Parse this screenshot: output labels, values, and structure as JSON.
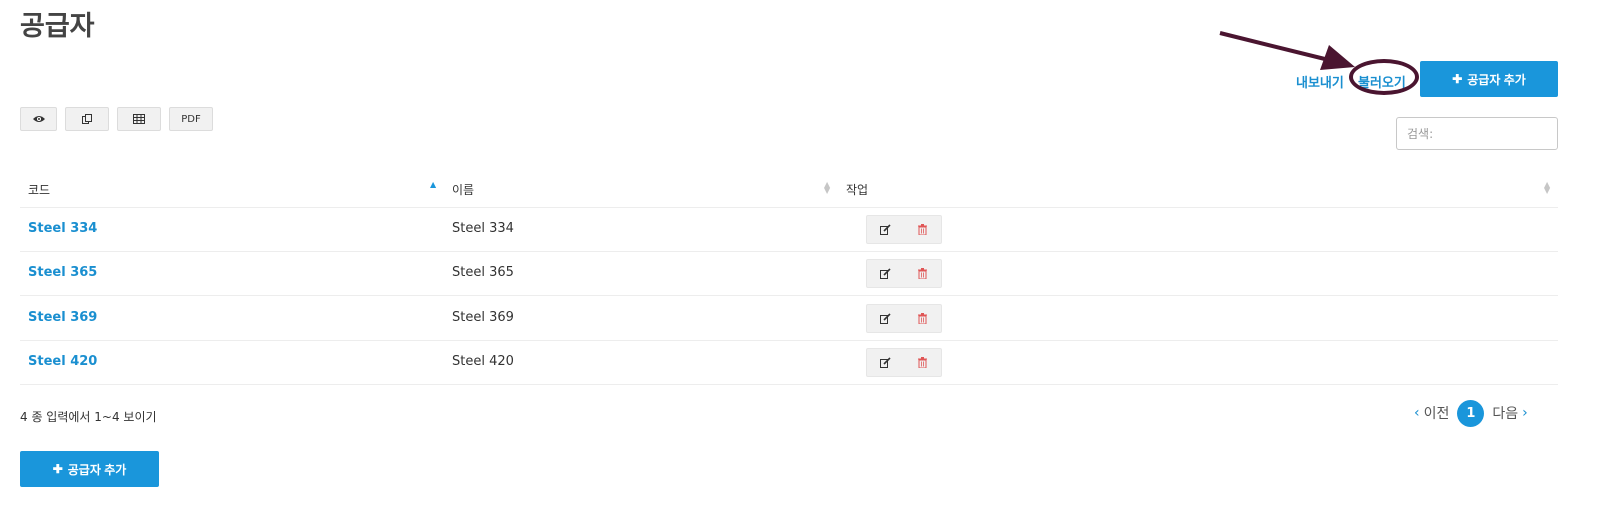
{
  "page": {
    "title": "공급자"
  },
  "actions": {
    "export_label": "내보내기",
    "import_label": "불러오기",
    "add_supplier_label": "공급자 추가",
    "add_icon": "plus-icon"
  },
  "toolbar": {
    "buttons": [
      {
        "icon": "eye-icon",
        "label": ""
      },
      {
        "icon": "copy-icon",
        "label": ""
      },
      {
        "icon": "table-icon",
        "label": ""
      },
      {
        "icon": "pdf",
        "label": "PDF"
      }
    ]
  },
  "search": {
    "placeholder": "검색:"
  },
  "table": {
    "columns": [
      {
        "label": "코드",
        "sort": "ascending"
      },
      {
        "label": "이름",
        "sort": "none"
      },
      {
        "label": "작업",
        "sort": "none"
      }
    ],
    "rows": [
      {
        "code": "Steel 334",
        "name": "Steel 334"
      },
      {
        "code": "Steel 365",
        "name": "Steel 365"
      },
      {
        "code": "Steel 369",
        "name": "Steel 369"
      },
      {
        "code": "Steel 420",
        "name": "Steel 420"
      }
    ],
    "row_actions": {
      "edit_icon": "edit-icon",
      "delete_icon": "trash-icon"
    }
  },
  "footer": {
    "info": "4 종 입력에서 1~4 보이기"
  },
  "pagination": {
    "prev_label": "이전",
    "current_page": "1",
    "next_label": "다음"
  },
  "colors": {
    "accent": "#1a96db",
    "link": "#1a8fd0",
    "annotation": "#4a1530",
    "delete": "#e05555"
  }
}
